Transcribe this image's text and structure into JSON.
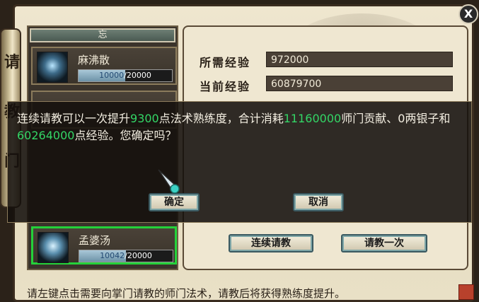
{
  "window": {
    "close_label": "X"
  },
  "scroll_chars": [
    "请",
    "教",
    "门"
  ],
  "skill_list": {
    "header": "忘",
    "items": [
      {
        "name": "麻沸散",
        "current": "10000",
        "max": "/20000",
        "progress": 0.5
      },
      {
        "name": "孟婆汤",
        "current": "10042",
        "max": "/20000",
        "progress": 0.502
      }
    ]
  },
  "exp": {
    "required_label": "所需经验",
    "required_value": "972000",
    "current_label": "当前经验",
    "current_value": "60879700"
  },
  "dialog": {
    "part1": "连续请教可以一次提升",
    "points": "9300",
    "part2": "点法术熟练度，合计消耗",
    "contribution": "11160000",
    "part3": "师门贡献、0两银子和",
    "exp_cost": "60264000",
    "part4": "点经验。您确定吗？",
    "confirm_label": "确定",
    "cancel_label": "取消"
  },
  "actions": {
    "continuous_label": "连续请教",
    "once_label": "请教一次"
  },
  "footer": {
    "text": "请左键点击需要向掌门请教的师门法术，请教后将获得熟练度提升。"
  }
}
